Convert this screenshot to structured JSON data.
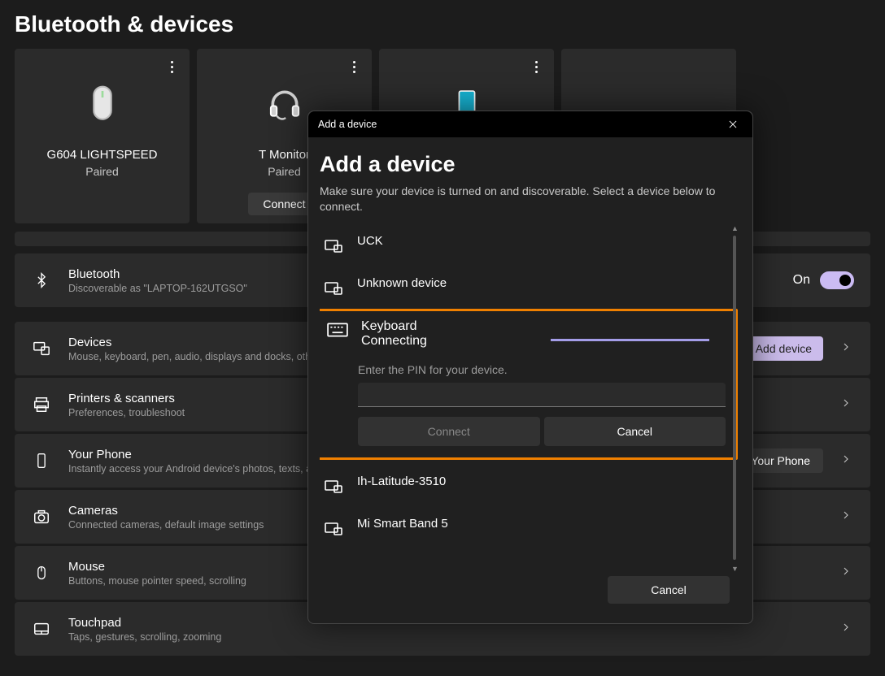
{
  "page": {
    "title": "Bluetooth & devices"
  },
  "tiles": [
    {
      "name": "G604 LIGHTSPEED",
      "status": "Paired",
      "icon": "mouse"
    },
    {
      "name": "T Monitor",
      "status": "Paired",
      "icon": "headset",
      "connect_label": "Connect"
    },
    {
      "icon": "phone"
    },
    {}
  ],
  "bluetooth_row": {
    "title": "Bluetooth",
    "sub": "Discoverable as \"LAPTOP-162UTGSO\"",
    "state_label": "On"
  },
  "rows": {
    "devices": {
      "title": "Devices",
      "sub": "Mouse, keyboard, pen, audio, displays and docks, other",
      "button": "Add device"
    },
    "printers": {
      "title": "Printers & scanners",
      "sub": "Preferences, troubleshoot"
    },
    "phone": {
      "title": "Your Phone",
      "sub": "Instantly access your Android device's photos, texts, and",
      "button": "Open Your Phone"
    },
    "cameras": {
      "title": "Cameras",
      "sub": "Connected cameras, default image settings"
    },
    "mouse": {
      "title": "Mouse",
      "sub": "Buttons, mouse pointer speed, scrolling"
    },
    "touchpad": {
      "title": "Touchpad",
      "sub": "Taps, gestures, scrolling, zooming"
    }
  },
  "dialog": {
    "titlebar": "Add a device",
    "heading": "Add a device",
    "sub": "Make sure your device is turned on and discoverable. Select a device below to connect.",
    "devices": {
      "d0": {
        "name": "UCK",
        "icon": "display"
      },
      "d1": {
        "name": "Unknown device",
        "icon": "display"
      },
      "d2": {
        "name": "Keyboard",
        "status": "Connecting",
        "icon": "keyboard",
        "pin_label": "Enter the PIN for your device.",
        "connect_label": "Connect",
        "cancel_label": "Cancel"
      },
      "d3": {
        "name": "Ih-Latitude-3510",
        "icon": "laptop"
      },
      "d4": {
        "name": "Mi Smart Band 5",
        "icon": "display"
      }
    },
    "footer_cancel": "Cancel"
  }
}
